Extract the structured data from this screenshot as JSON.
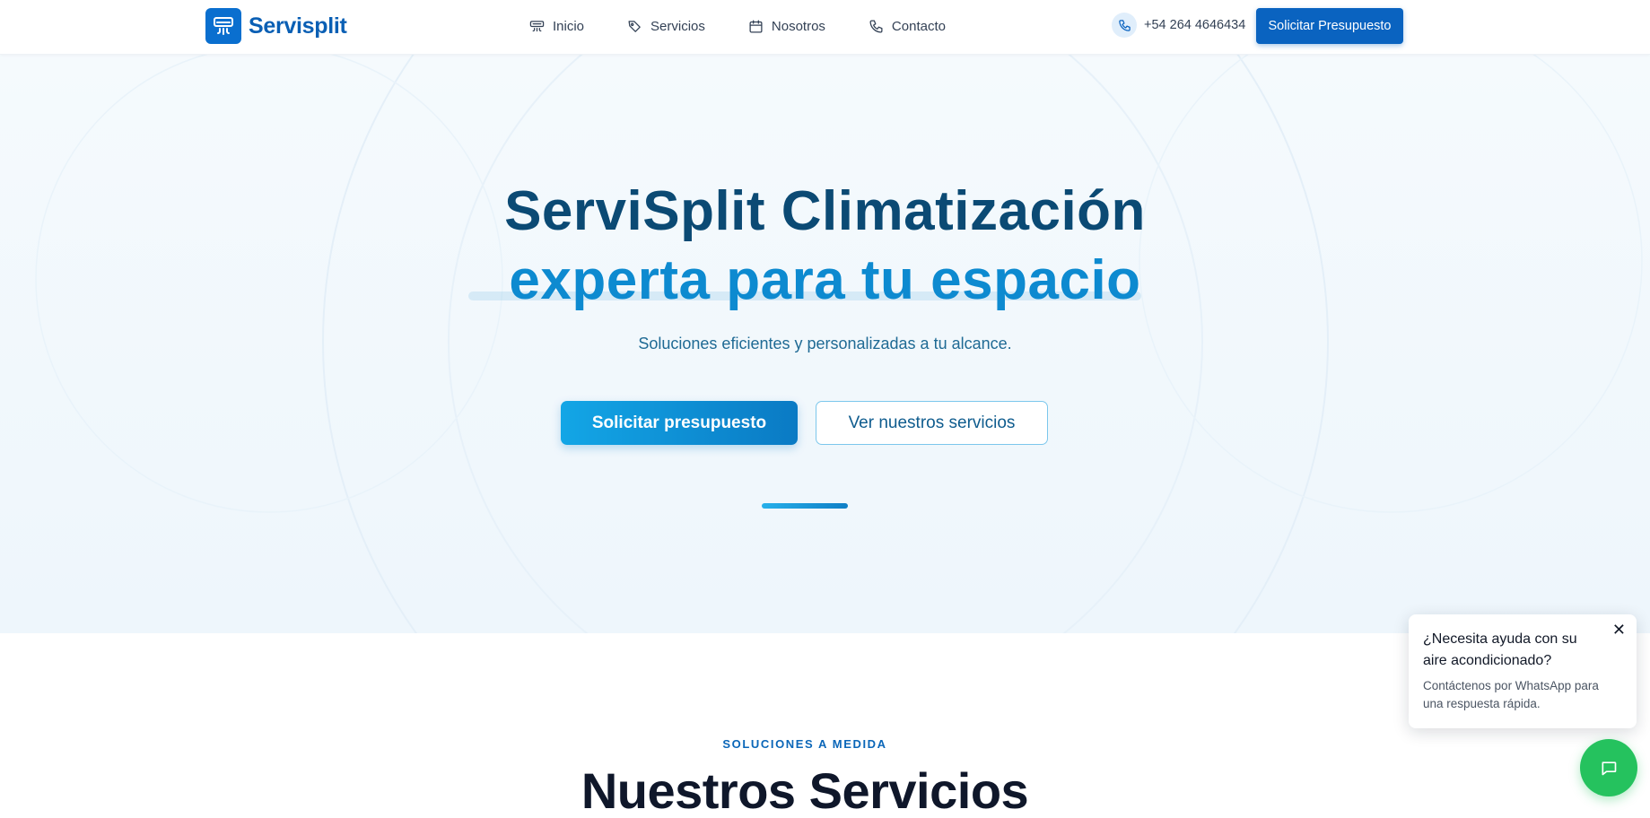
{
  "header": {
    "logo_text": "Servisplit",
    "nav": [
      {
        "label": "Inicio",
        "icon": "air-conditioner-icon"
      },
      {
        "label": "Servicios",
        "icon": "tag-icon"
      },
      {
        "label": "Nosotros",
        "icon": "calendar-icon"
      },
      {
        "label": "Contacto",
        "icon": "phone-icon"
      }
    ],
    "phone": "+54 264 4646434",
    "cta_label": "Solicitar Presupuesto"
  },
  "hero": {
    "title_line1": "ServiSplit Climatización",
    "title_line2": "experta para tu espacio",
    "subtitle": "Soluciones eficientes y personalizadas a tu alcance.",
    "primary_button": "Solicitar presupuesto",
    "secondary_button": "Ver nuestros servicios"
  },
  "services": {
    "eyebrow": "SOLUCIONES A MEDIDA",
    "title": "Nuestros Servicios"
  },
  "chat": {
    "title": "¿Necesita ayuda con su aire acondicionado?",
    "body": "Contáctenos por WhatsApp para una respuesta rápida.",
    "close_glyph": "✕"
  },
  "colors": {
    "brand": "#0a63c0",
    "accent": "#0d8ad0",
    "title_dark": "#0b4a74",
    "whatsapp": "#25c25e"
  }
}
